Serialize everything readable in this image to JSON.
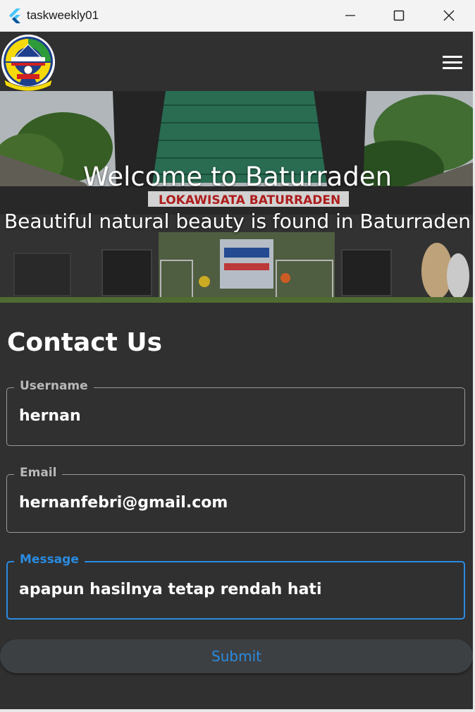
{
  "window": {
    "title": "taskweekly01",
    "app_icon": "flutter-icon",
    "controls": [
      "minimize-icon",
      "maximize-icon",
      "close-icon"
    ]
  },
  "appbar": {
    "logo": "regency-emblem-logo",
    "menu_icon": "hamburger-menu-icon"
  },
  "hero": {
    "title": "Welcome to Baturraden",
    "subtitle": "Beautiful natural beauty is found in Baturraden",
    "sign_text": "LOKAWISATA BATURRADEN"
  },
  "contact": {
    "heading": "Contact Us",
    "fields": {
      "username": {
        "label": "Username",
        "value": "hernan"
      },
      "email": {
        "label": "Email",
        "value": "hernanfebri@gmail.com"
      },
      "message": {
        "label": "Message",
        "value": "apapun hasilnya tetap rendah hati",
        "focused": true
      }
    },
    "submit_label": "Submit"
  },
  "colors": {
    "background": "#303030",
    "accent": "#2a8be0",
    "field_border": "#9a9a9a",
    "button_bg": "#3d4043"
  }
}
